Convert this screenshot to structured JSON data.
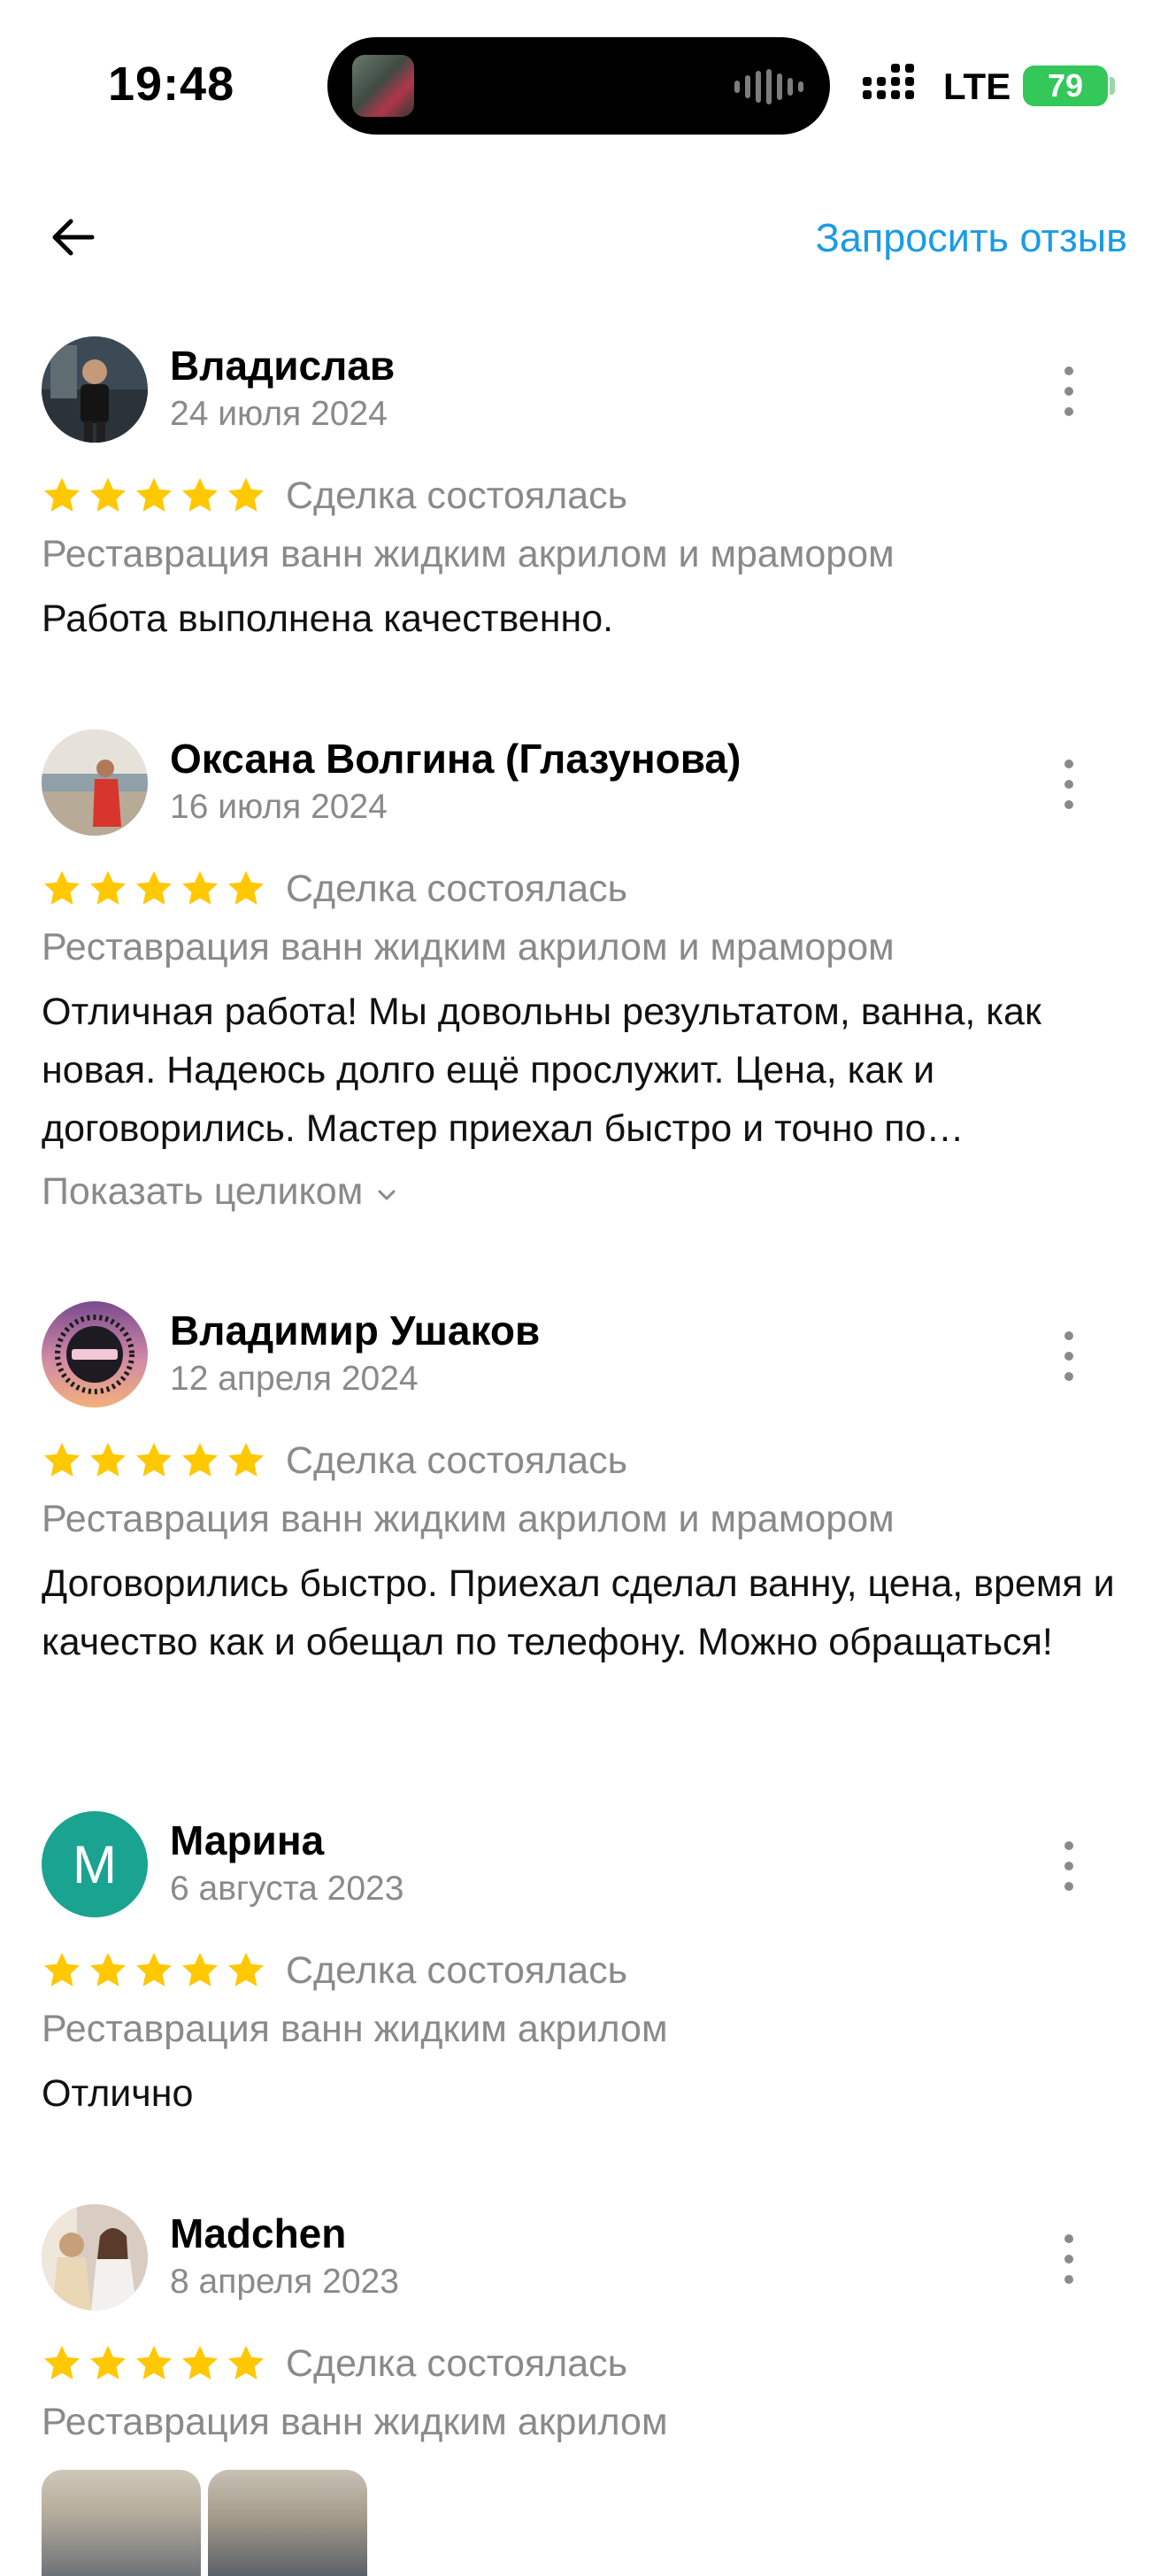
{
  "status_bar": {
    "time": "19:48",
    "network": "LTE",
    "battery": "79"
  },
  "header": {
    "request_review_label": "Запросить отзыв"
  },
  "colors": {
    "accent_link": "#1a9be8",
    "star": "#ffc800",
    "muted_text": "#8a8a8a",
    "letter_avatar_bg": "#1ba392"
  },
  "reviews": [
    {
      "name": "Владислав",
      "date": "24 июля 2024",
      "rating": 5,
      "deal_status": "Сделка состоялась",
      "service": "Реставрация ванн жидким акрилом и мрамором",
      "text": "Работа выполнена качественно."
    },
    {
      "name": "Оксана Волгина (Глазунова)",
      "date": "16 июля 2024",
      "rating": 5,
      "deal_status": "Сделка состоялась",
      "service": "Реставрация ванн жидким акрилом и мрамором",
      "text": "Отличная работа! Мы довольны результатом, ванна, как новая. Надеюсь долго ещё прослужит. Цена, как и договорились. Мастер приехал быстро и точно по…",
      "show_more_label": "Показать целиком"
    },
    {
      "name": "Владимир Ушаков",
      "date": "12 апреля 2024",
      "rating": 5,
      "deal_status": "Сделка состоялась",
      "service": "Реставрация ванн жидким акрилом и мрамором",
      "text": "Договорились быстро. Приехал сделал ванну, цена, время и качество как и обещал по телефону. Можно обращаться!"
    },
    {
      "name": "Марина",
      "date": "6 августа 2023",
      "avatar_letter": "М",
      "rating": 5,
      "deal_status": "Сделка состоялась",
      "service": "Реставрация ванн жидким акрилом",
      "text": "Отлично"
    },
    {
      "name": "Madchen",
      "date": "8 апреля 2023",
      "rating": 5,
      "deal_status": "Сделка состоялась",
      "service": "Реставрация ванн жидким акрилом"
    }
  ]
}
